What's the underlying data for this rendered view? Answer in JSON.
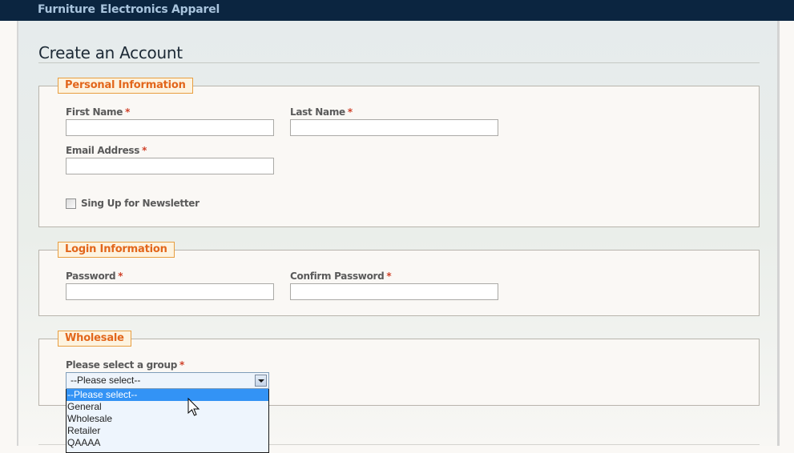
{
  "nav": {
    "items": [
      {
        "label": "Furniture"
      },
      {
        "label": "Electronics"
      },
      {
        "label": "Apparel"
      }
    ]
  },
  "page": {
    "title": "Create an Account"
  },
  "personal": {
    "legend": "Personal Information",
    "first_name_label": "First Name",
    "first_name_value": "",
    "last_name_label": "Last Name",
    "last_name_value": "",
    "email_label": "Email Address",
    "email_value": "",
    "newsletter_label": "Sing Up for Newsletter",
    "newsletter_checked": false
  },
  "login": {
    "legend": "Login Information",
    "password_label": "Password",
    "password_value": "",
    "confirm_label": "Confirm Password",
    "confirm_value": ""
  },
  "wholesale": {
    "legend": "Wholesale",
    "group_label": "Please select a group",
    "selected": "--Please select--",
    "options": [
      "--Please select--",
      "General",
      "Wholesale",
      "Retailer",
      "QAAAA"
    ]
  },
  "required_marker": "*",
  "colors": {
    "nav_bg": "#0b2540",
    "nav_text": "#a9c4dd",
    "legend_text": "#e2661b",
    "legend_border": "#e89e40",
    "required": "#d0422a",
    "option_highlight": "#3393f5"
  }
}
